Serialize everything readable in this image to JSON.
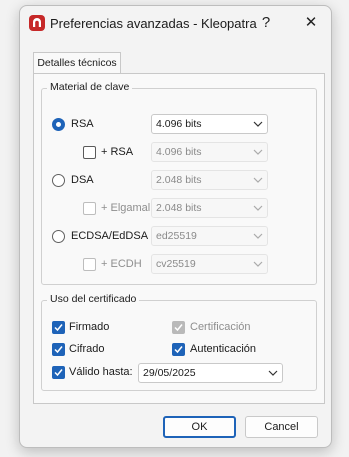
{
  "window": {
    "title": "Preferencias avanzadas - Kleopatra",
    "help_glyph": "?",
    "close_glyph": "✕",
    "app_icon": "kleopatra-icon"
  },
  "tab": {
    "label": "Detalles técnicos"
  },
  "key_material": {
    "title": "Material de clave",
    "options": [
      {
        "label": "RSA",
        "checked": true,
        "combo": "4.096 bits",
        "enabled": true,
        "sub": {
          "label": "+ RSA",
          "checked": false,
          "enabled": true,
          "combo": "4.096 bits"
        }
      },
      {
        "label": "DSA",
        "checked": false,
        "combo": "2.048 bits",
        "enabled": false,
        "sub": {
          "label": "+ Elgamal",
          "checked": false,
          "enabled": false,
          "combo": "2.048 bits"
        }
      },
      {
        "label": "ECDSA/EdDSA",
        "checked": false,
        "combo": "ed25519",
        "enabled": false,
        "sub": {
          "label": "+ ECDH",
          "checked": false,
          "enabled": false,
          "combo": "cv25519"
        }
      }
    ]
  },
  "cert_usage": {
    "title": "Uso del certificado",
    "signed": {
      "label": "Firmado",
      "checked": true
    },
    "certification": {
      "label": "Certificación",
      "checked": true,
      "enabled": false
    },
    "encrypted": {
      "label": "Cifrado",
      "checked": true
    },
    "authentication": {
      "label": "Autenticación",
      "checked": true
    },
    "valid_until": {
      "label": "Válido hasta:",
      "checked": true,
      "date": "29/05/2025"
    }
  },
  "buttons": {
    "ok": "OK",
    "cancel": "Cancel"
  },
  "colors": {
    "accent": "#1e63b8",
    "logo": "#c62828"
  }
}
